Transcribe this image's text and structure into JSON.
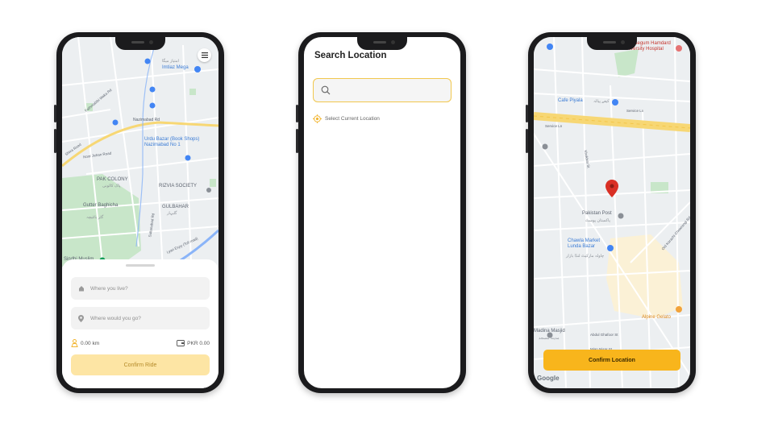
{
  "phone1": {
    "map_labels": {
      "imtiaz": "Imtiaz Mega",
      "imtiaz_urdu": "امتیاز میگا",
      "fathmabibi": "Fathmabibi Waka Rd",
      "nazimabad": "Nazimabad Rd",
      "noor_jehan": "Noor Jehan Road",
      "service": "Shiva Road",
      "urdu_bazar": "Urdu Bazar (Book Shops) Nazimabad No 1",
      "pak_colony": "PAK COLONY",
      "pak_colony_urdu": "پاک کالونی",
      "gutter": "Gutter Baghicha",
      "gutter_urdu": "گٹر باغیچہ",
      "rizvia": "RIZVIA SOCIETY",
      "gulbahar": "GULBAHAR",
      "gulbahar_urdu": "گلبہار",
      "lyari": "Lyari Expy (Toll road)",
      "sindhi": "Sindhi Muslim",
      "sultanabad": "Sultanabad Rd"
    },
    "from_placeholder": "Where you live?",
    "to_placeholder": "Where would you go?",
    "distance": "0.00 km",
    "fare": "PKR 0.00",
    "confirm_label": "Confirm Ride"
  },
  "phone2": {
    "title": "Search Location",
    "search_placeholder": "",
    "current_location_label": "Select Current Location"
  },
  "phone3": {
    "map_labels": {
      "hamdard": "Nazmat Begum Hamdard University Hospital",
      "cafe": "Cafe Piyala",
      "cafe_urdu": "کیفے پیالہ",
      "service1": "Service Ln",
      "service2": "Service Ln",
      "khokhar": "Khokhar St",
      "pakistan_post": "Pakistan Post",
      "pakistan_post_urdu": "پاکستان پوسٹ",
      "chawla": "Chawla Market Lunda Bazar",
      "chawla_urdu": "چاولہ مارکیٹ لنڈا بازار",
      "old_karachi": "Old Karachi Chowrangi Rd",
      "alpine": "Alpine Gelato",
      "madina": "Madina Masjid",
      "madina_urdu": "مدینہ مسجد",
      "abdul": "Abdul Ghafoor St",
      "mian": "Mian Nisar St"
    },
    "confirm_label": "Confirm Location",
    "google_label": "Google"
  },
  "colors": {
    "accent": "#F8B51C",
    "accent_light": "#FDE5A4",
    "pin": "#D93025",
    "map_bg": "#ECEFF1",
    "park": "#C8E6C9"
  }
}
